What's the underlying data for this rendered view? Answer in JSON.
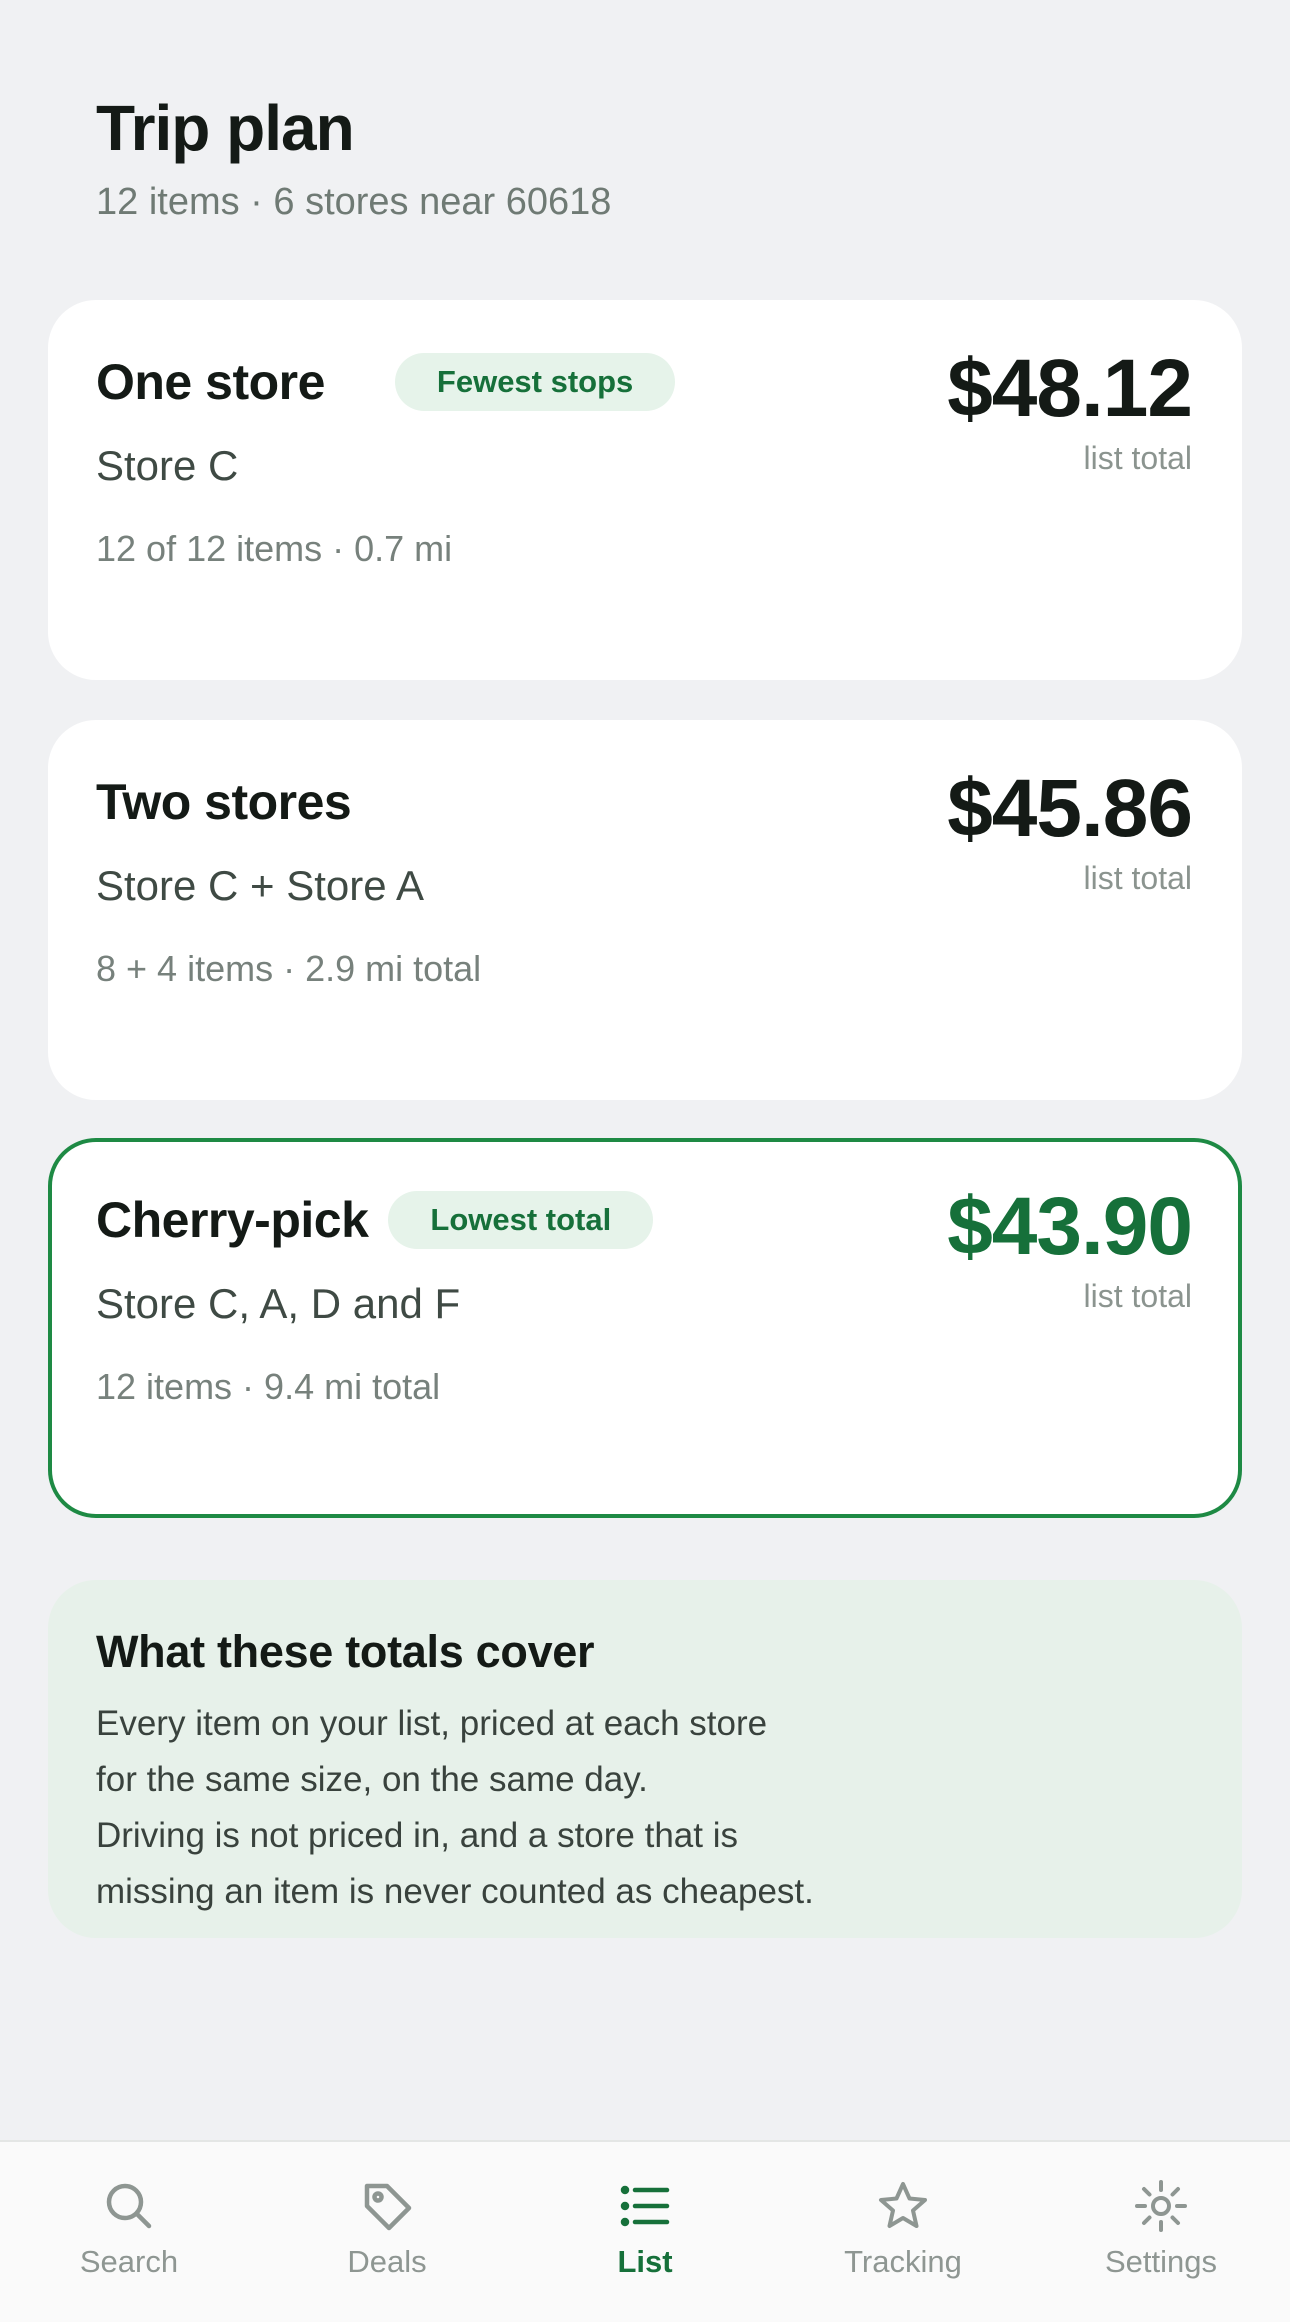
{
  "header": {
    "title": "Trip plan",
    "subtitle": "12 items · 6 stores near 60618"
  },
  "plans": [
    {
      "title": "One store",
      "badge": "Fewest stops",
      "price": "$48.12",
      "price_caption": "list total",
      "stores": "Store C",
      "meta": "12 of 12 items · 0.7 mi"
    },
    {
      "title": "Two stores",
      "price": "$45.86",
      "price_caption": "list total",
      "stores": "Store C + Store A",
      "meta": "8 + 4 items · 2.9 mi total"
    },
    {
      "title": "Cherry-pick",
      "badge": "Lowest total",
      "price": "$43.90",
      "price_caption": "list total",
      "stores": "Store C, A, D and F",
      "meta": "12 items · 9.4 mi total",
      "selected": true
    }
  ],
  "info": {
    "title": "What these totals cover",
    "lines": [
      "Every item on your list, priced at each store",
      "for the same size, on the same day.",
      "Driving is not priced in, and a store that is",
      "missing an item is never counted as cheapest."
    ]
  },
  "tabs": [
    {
      "label": "Search",
      "icon": "search-icon"
    },
    {
      "label": "Deals",
      "icon": "tag-icon"
    },
    {
      "label": "List",
      "icon": "list-icon",
      "active": true
    },
    {
      "label": "Tracking",
      "icon": "star-icon"
    },
    {
      "label": "Settings",
      "icon": "gear-icon"
    }
  ],
  "colors": {
    "accent": "#16703a",
    "selected_border": "#1e8a44",
    "badge_bg": "#e6f3ea",
    "info_bg": "#e7f1ea",
    "page_bg": "#f0f1f3"
  }
}
